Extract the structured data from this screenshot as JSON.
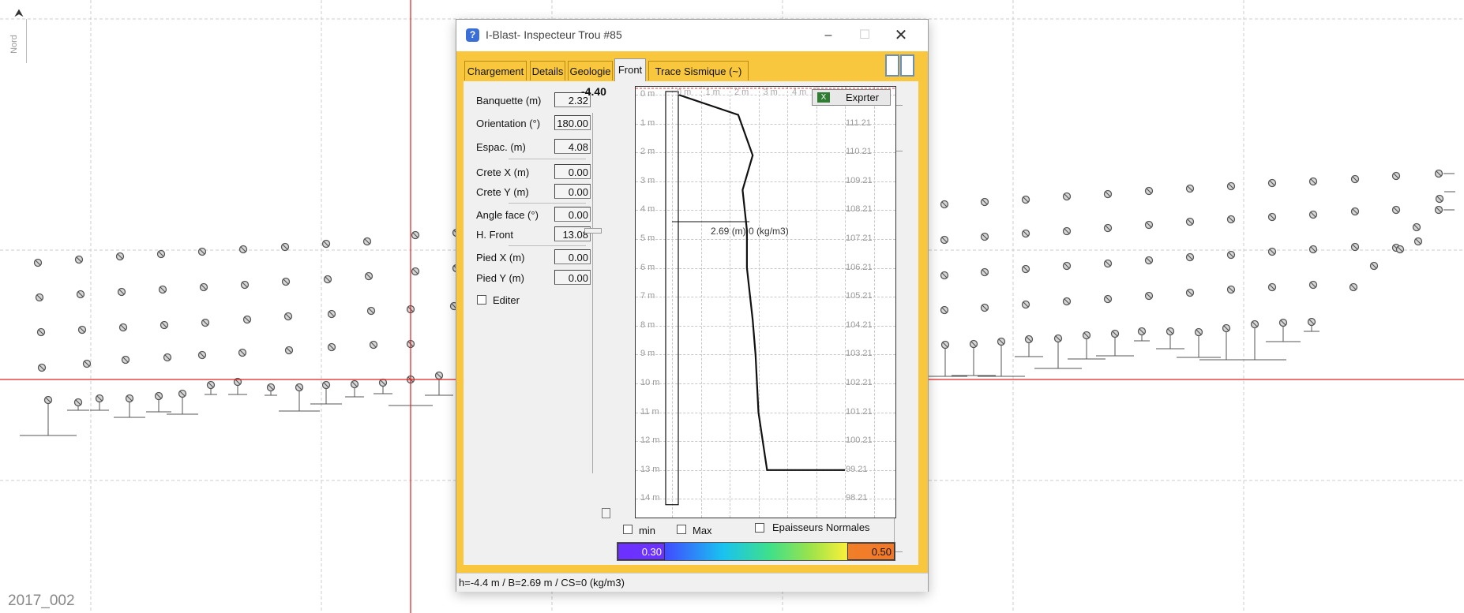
{
  "map": {
    "north_label": "Nord",
    "north_arrow": "arrow-up",
    "project_name": "2017_002",
    "crosshair_color": "#e0201c",
    "grid_color": "#cccccc",
    "hole_marker_color": "#555555"
  },
  "window": {
    "title": "I-Blast- Inspecteur Trou #85",
    "app_icon": "help-icon",
    "controls": [
      "minimize",
      "maximize",
      "close"
    ],
    "accent_color": "#f8c73d"
  },
  "tabs": [
    {
      "label": "Chargement",
      "active": false
    },
    {
      "label": "Details",
      "active": false
    },
    {
      "label": "Geologie",
      "active": false
    },
    {
      "label": "Front",
      "active": true
    },
    {
      "label": "Trace Sismique (~)",
      "active": false
    }
  ],
  "params": {
    "banquette": {
      "label": "Banquette (m)",
      "value": "2.32"
    },
    "orientation": {
      "label": "Orientation (°)",
      "value": "180.00"
    },
    "espac": {
      "label": "Espac. (m)",
      "value": "4.08"
    },
    "crete_x": {
      "label": "Crete X (m)",
      "value": "0.00"
    },
    "crete_y": {
      "label": "Crete Y (m)",
      "value": "0.00"
    },
    "angle_face": {
      "label": "Angle face (°)",
      "value": "0.00"
    },
    "h_front": {
      "label": "H. Front",
      "value": "13.08"
    },
    "pied_x": {
      "label": "Pied X (m)",
      "value": "0.00"
    },
    "pied_y": {
      "label": "Pied Y (m)",
      "value": "0.00"
    },
    "editer": {
      "label": "Editer",
      "checked": false
    }
  },
  "depth_indicator": "-4.40",
  "export_button": {
    "label": "Exprter",
    "icon": "excel-icon"
  },
  "front_chart": {
    "x_labels": [
      "0 m",
      "1 m",
      "2 m",
      "3 m",
      "4 m"
    ],
    "depth_labels": [
      "0 m",
      "1 m",
      "2 m",
      "3 m",
      "4 m",
      "5 m",
      "6 m",
      "7 m",
      "8 m",
      "9 m",
      "10 m",
      "11 m",
      "12 m",
      "13 m",
      "14 m"
    ],
    "elevation_labels": [
      "",
      "111.21",
      "110.21",
      "109.21",
      "108.21",
      "107.21",
      "106.21",
      "105.21",
      "104.21",
      "103.21",
      "102.21",
      "101.21",
      "100.21",
      "99.21",
      "98.21"
    ],
    "annotation": "2.69  (m)  0 (kg/m3)"
  },
  "chart_data": {
    "type": "line",
    "x_unit": "m",
    "y_unit": "m",
    "xlim": [
      0,
      4
    ],
    "ylim": [
      0,
      14
    ],
    "series": [
      {
        "points": [
          [
            0.0,
            0.0
          ],
          [
            2.3,
            0.7
          ],
          [
            2.8,
            2.1
          ],
          [
            2.45,
            3.3
          ],
          [
            2.6,
            4.7
          ],
          [
            2.6,
            6.0
          ],
          [
            2.8,
            7.8
          ],
          [
            2.9,
            9.0
          ],
          [
            3.0,
            11.0
          ],
          [
            3.3,
            13.0
          ],
          [
            6.0,
            13.0
          ]
        ]
      }
    ],
    "cursor_depth": 4.4,
    "cursor_value": 2.69,
    "hole_column": {
      "x_from": 0.2,
      "x_to": 0.65,
      "depth_to": 14.2
    }
  },
  "checkboxes": [
    {
      "label": "min",
      "checked": false
    },
    {
      "label": "Max",
      "checked": false
    },
    {
      "label": "Epaisseurs Normales",
      "checked": false
    }
  ],
  "color_scale": {
    "min": "0.30",
    "max": "0.50"
  },
  "status_text": "h=-4.4 m / B=2.69 m / CS=0  (kg/m3)"
}
